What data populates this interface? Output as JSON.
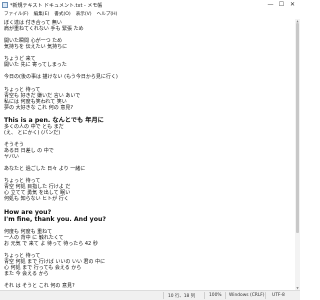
{
  "window": {
    "title": "*新規テキスト ドキュメント.txt - メモ帳",
    "controls": {
      "minimize": "—",
      "maximize": "☐",
      "close": "✕"
    }
  },
  "menu": [
    "ファイル(F)",
    "編集(E)",
    "書式(O)",
    "表示(V)",
    "ヘルプ(H)"
  ],
  "lines": [
    "ぼく達は 付き合って 無い",
    "肩が重ねてくれない 手も 緊張 ため",
    "",
    "開いた瞬間 心が一つ ため",
    "気持ちを 伝えたい 気持ちに",
    "",
    "ちょうど 来て",
    "開いた 先に 寄ってしまった",
    "",
    "今日の(後の事は 描けない (もう今日から見に行く)",
    "",
    "ちょっと 待って",
    "青空も 好きだ 嫌いだ 言い あいで",
    "私には 何度も笑われて 笑い",
    "夢の 大好きな これ 何の 意見?",
    "",
    "This is a pen. なんとでも 年月に",
    "多くの人の 中で とも まだ",
    "(え、 とにかく) (パンだ)",
    "",
    "そうそう",
    "ある日 日差し の 中で",
    "ヤバい",
    "",
    "あなたと 過ごした 日々 より 一緒に",
    "",
    "ちょっと 待って",
    "青空 何処 目指した 行けよ だ",
    "心 立てて 勇気 を出して 眠い",
    "何処も 知らない ヒトが 行く",
    "",
    "How are you?",
    "I'm fine, thank you. And you?",
    "",
    "何度も 何度も 重ねて",
    "一人の 背中 に 触れたくて",
    "お 元気 で 来て よ 待って 待ったら 42 秒",
    "",
    "ちょっと 待って",
    "青空 何処 まで 行けば いいの いい 君の 中に",
    "心 何処 まで 行っても 会える から",
    "また 今 会える から",
    "",
    "それ は そうと これ 何の 意見?"
  ],
  "status": {
    "position": "10 行、18 列",
    "zoom": "100%",
    "line_ending": "Windows (CRLF)",
    "encoding": "UTF-8"
  }
}
